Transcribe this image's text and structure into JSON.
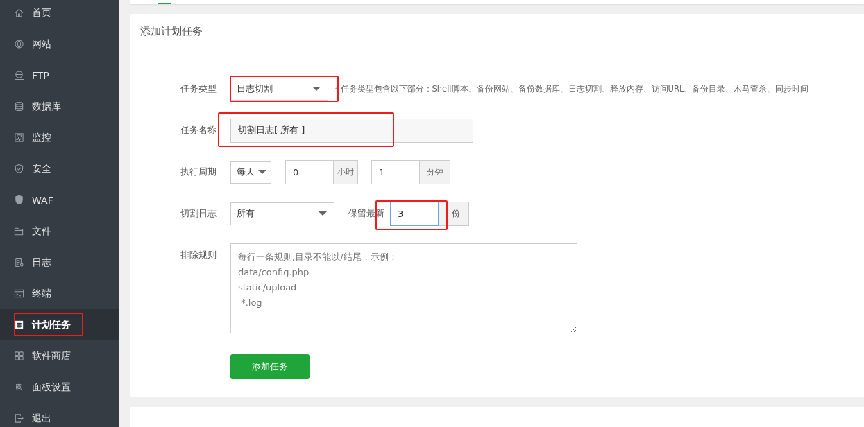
{
  "sidebar": {
    "items": [
      {
        "label": "首页",
        "selected": false
      },
      {
        "label": "网站",
        "selected": false
      },
      {
        "label": "FTP",
        "selected": false
      },
      {
        "label": "数据库",
        "selected": false
      },
      {
        "label": "监控",
        "selected": false
      },
      {
        "label": "安全",
        "selected": false
      },
      {
        "label": "WAF",
        "selected": false
      },
      {
        "label": "文件",
        "selected": false
      },
      {
        "label": "日志",
        "selected": false
      },
      {
        "label": "终端",
        "selected": false
      },
      {
        "label": "计划任务",
        "selected": true
      },
      {
        "label": "软件商店",
        "selected": false
      },
      {
        "label": "面板设置",
        "selected": false
      },
      {
        "label": "退出",
        "selected": false
      }
    ]
  },
  "panel": {
    "title": "添加计划任务",
    "task_type": {
      "label": "任务类型",
      "value": "日志切割",
      "hint_mark": "*",
      "hint": "任务类型包含以下部分：Shell脚本、备份网站、备份数据库、日志切割、释放内存、访问URL、备份目录、木马查杀、同步时间"
    },
    "task_name": {
      "label": "任务名称",
      "value": "切割日志[ 所有 ]"
    },
    "period": {
      "label": "执行周期",
      "cycle": "每天",
      "hour": "0",
      "hour_unit": "小时",
      "minute": "1",
      "minute_unit": "分钟"
    },
    "cut_log": {
      "label": "切割日志",
      "value": "所有",
      "keep_label": "保留最新",
      "keep": "3",
      "keep_unit": "份"
    },
    "exclude": {
      "label": "排除规则",
      "placeholder": "每行一条规则,目录不能以/结尾，示例：\ndata/config.php\nstatic/upload\n *.log"
    },
    "submit": "添加任务"
  }
}
